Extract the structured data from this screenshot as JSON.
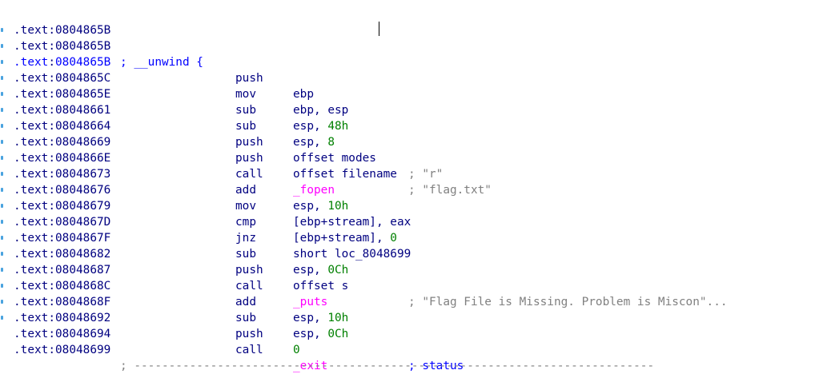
{
  "listing": {
    "lines": [
      {
        "segment": ".text",
        "offset": "0804865B",
        "label_comment": "; __unwind {"
      },
      {
        "segment": ".text",
        "offset": "0804865B",
        "mnemonic": "push",
        "operands": "ebp"
      },
      {
        "segment": ".text",
        "offset": "0804865C",
        "mnemonic": "mov",
        "operands": "ebp, esp"
      },
      {
        "segment": ".text",
        "offset": "0804865E",
        "mnemonic": "sub",
        "op_reg": "esp, ",
        "op_num": "48h"
      },
      {
        "segment": ".text",
        "offset": "08048661",
        "mnemonic": "sub",
        "op_reg": "esp, ",
        "op_num": "8"
      },
      {
        "segment": ".text",
        "offset": "08048664",
        "mnemonic": "push",
        "operands": "offset modes",
        "comment": "; \"r\""
      },
      {
        "segment": ".text",
        "offset": "08048669",
        "mnemonic": "push",
        "operands": "offset filename",
        "comment": "; \"flag.txt\""
      },
      {
        "segment": ".text",
        "offset": "0804866E",
        "mnemonic": "call",
        "import": "_fopen"
      },
      {
        "segment": ".text",
        "offset": "08048673",
        "mnemonic": "add",
        "op_reg": "esp, ",
        "op_num": "10h"
      },
      {
        "segment": ".text",
        "offset": "08048676",
        "mnemonic": "mov",
        "operands": "[ebp+stream], eax"
      },
      {
        "segment": ".text",
        "offset": "08048679",
        "mnemonic": "cmp",
        "op_reg": "[ebp+stream], ",
        "op_num": "0"
      },
      {
        "segment": ".text",
        "offset": "0804867D",
        "mnemonic": "jnz",
        "operands": "short loc_8048699"
      },
      {
        "segment": ".text",
        "offset": "0804867F",
        "mnemonic": "sub",
        "op_reg": "esp, ",
        "op_num": "0Ch"
      },
      {
        "segment": ".text",
        "offset": "08048682",
        "mnemonic": "push",
        "operands": "offset s",
        "comment": "; \"Flag File is Missing. Problem is Miscon\"..."
      },
      {
        "segment": ".text",
        "offset": "08048687",
        "mnemonic": "call",
        "import": "_puts"
      },
      {
        "segment": ".text",
        "offset": "0804868C",
        "mnemonic": "add",
        "op_reg": "esp, ",
        "op_num": "10h"
      },
      {
        "segment": ".text",
        "offset": "0804868F",
        "mnemonic": "sub",
        "op_reg": "esp, ",
        "op_num": "0Ch"
      },
      {
        "segment": ".text",
        "offset": "08048692",
        "mnemonic": "push",
        "op_num_only": "0",
        "comment_blue": "; status"
      },
      {
        "segment": ".text",
        "offset": "08048694",
        "mnemonic": "call",
        "import": "_exit"
      },
      {
        "segment": ".text",
        "offset": "08048699",
        "separator": "; ---------------------------------------------------------------------------"
      }
    ]
  },
  "colors": {
    "address": "#000080",
    "address_selected": "#0000ff",
    "number": "#008000",
    "import_function": "#ff00ff",
    "comment": "#808080",
    "comment_blue": "#0000ff",
    "marker": "#4aa3df"
  }
}
